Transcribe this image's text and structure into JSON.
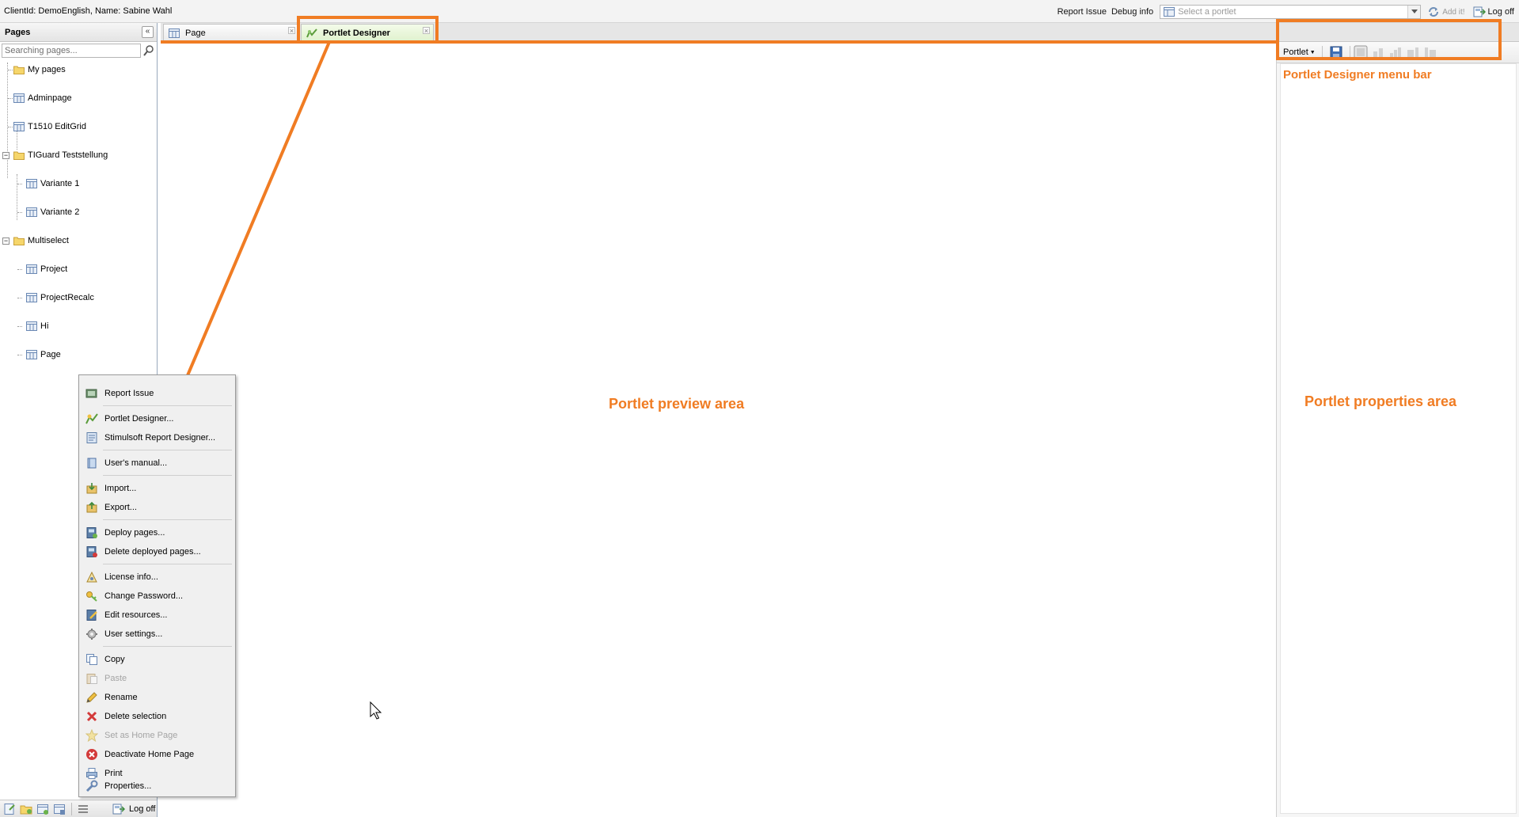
{
  "header": {
    "client_info": "ClientId: DemoEnglish, Name: Sabine Wahl",
    "report_issue": "Report Issue",
    "debug_info": "Debug info",
    "portlet_select_placeholder": "Select a portlet",
    "add_it": "Add it!",
    "log_off": "Log off"
  },
  "pages_panel": {
    "title": "Pages",
    "search_placeholder": "Searching pages...",
    "tree": [
      {
        "label": "My pages",
        "type": "folder"
      },
      {
        "label": "Adminpage",
        "type": "page"
      },
      {
        "label": "T1510 EditGrid",
        "type": "page"
      },
      {
        "label": "TIGuard Teststellung",
        "type": "folder"
      },
      {
        "label": "Variante 1",
        "type": "page"
      },
      {
        "label": "Variante 2",
        "type": "page"
      },
      {
        "label": "Multiselect",
        "type": "folder"
      },
      {
        "label": "Project",
        "type": "page"
      },
      {
        "label": "ProjectRecalc",
        "type": "page"
      },
      {
        "label": "Hi",
        "type": "page"
      },
      {
        "label": "Page",
        "type": "page"
      }
    ],
    "bottom_log_off": "Log off"
  },
  "tabs": [
    {
      "label": "Page"
    },
    {
      "label": "Portlet Designer"
    }
  ],
  "designer_toolbar": {
    "portlet_menu": "Portlet"
  },
  "annotations": {
    "preview_area": "Portlet preview area",
    "properties_area": "Portlet properties area",
    "menu_bar": "Portlet Designer menu bar"
  },
  "context_menu": [
    {
      "label": "Report Issue",
      "icon": "report-icon",
      "enabled": true
    },
    {
      "label": "Portlet Designer...",
      "icon": "designer-icon",
      "enabled": true
    },
    {
      "label": "Stimulsoft Report Designer...",
      "icon": "report-designer-icon",
      "enabled": true
    },
    {
      "label": "User's manual...",
      "icon": "manual-icon",
      "enabled": true
    },
    {
      "label": "Import...",
      "icon": "import-icon",
      "enabled": true
    },
    {
      "label": "Export...",
      "icon": "export-icon",
      "enabled": true
    },
    {
      "label": "Deploy pages...",
      "icon": "deploy-icon",
      "enabled": true
    },
    {
      "label": "Delete deployed pages...",
      "icon": "delete-deployed-icon",
      "enabled": true
    },
    {
      "label": "License info...",
      "icon": "license-icon",
      "enabled": true
    },
    {
      "label": "Change Password...",
      "icon": "key-icon",
      "enabled": true
    },
    {
      "label": "Edit resources...",
      "icon": "edit-resources-icon",
      "enabled": true
    },
    {
      "label": "User settings...",
      "icon": "gear-icon",
      "enabled": true
    },
    {
      "label": "Copy",
      "icon": "copy-icon",
      "enabled": true
    },
    {
      "label": "Paste",
      "icon": "paste-icon",
      "enabled": false
    },
    {
      "label": "Rename",
      "icon": "pencil-icon",
      "enabled": true
    },
    {
      "label": "Delete selection",
      "icon": "delete-icon",
      "enabled": true
    },
    {
      "label": "Set as Home Page",
      "icon": "star-icon",
      "enabled": false
    },
    {
      "label": "Deactivate Home Page",
      "icon": "deactivate-icon",
      "enabled": true
    },
    {
      "label": "Print",
      "icon": "print-icon",
      "enabled": true
    },
    {
      "label": "Properties...",
      "icon": "wrench-icon",
      "enabled": true
    }
  ],
  "colors": {
    "annotation": "#f07c23",
    "panel_border": "#99a9bd",
    "active_tab": "#dff1cc"
  }
}
